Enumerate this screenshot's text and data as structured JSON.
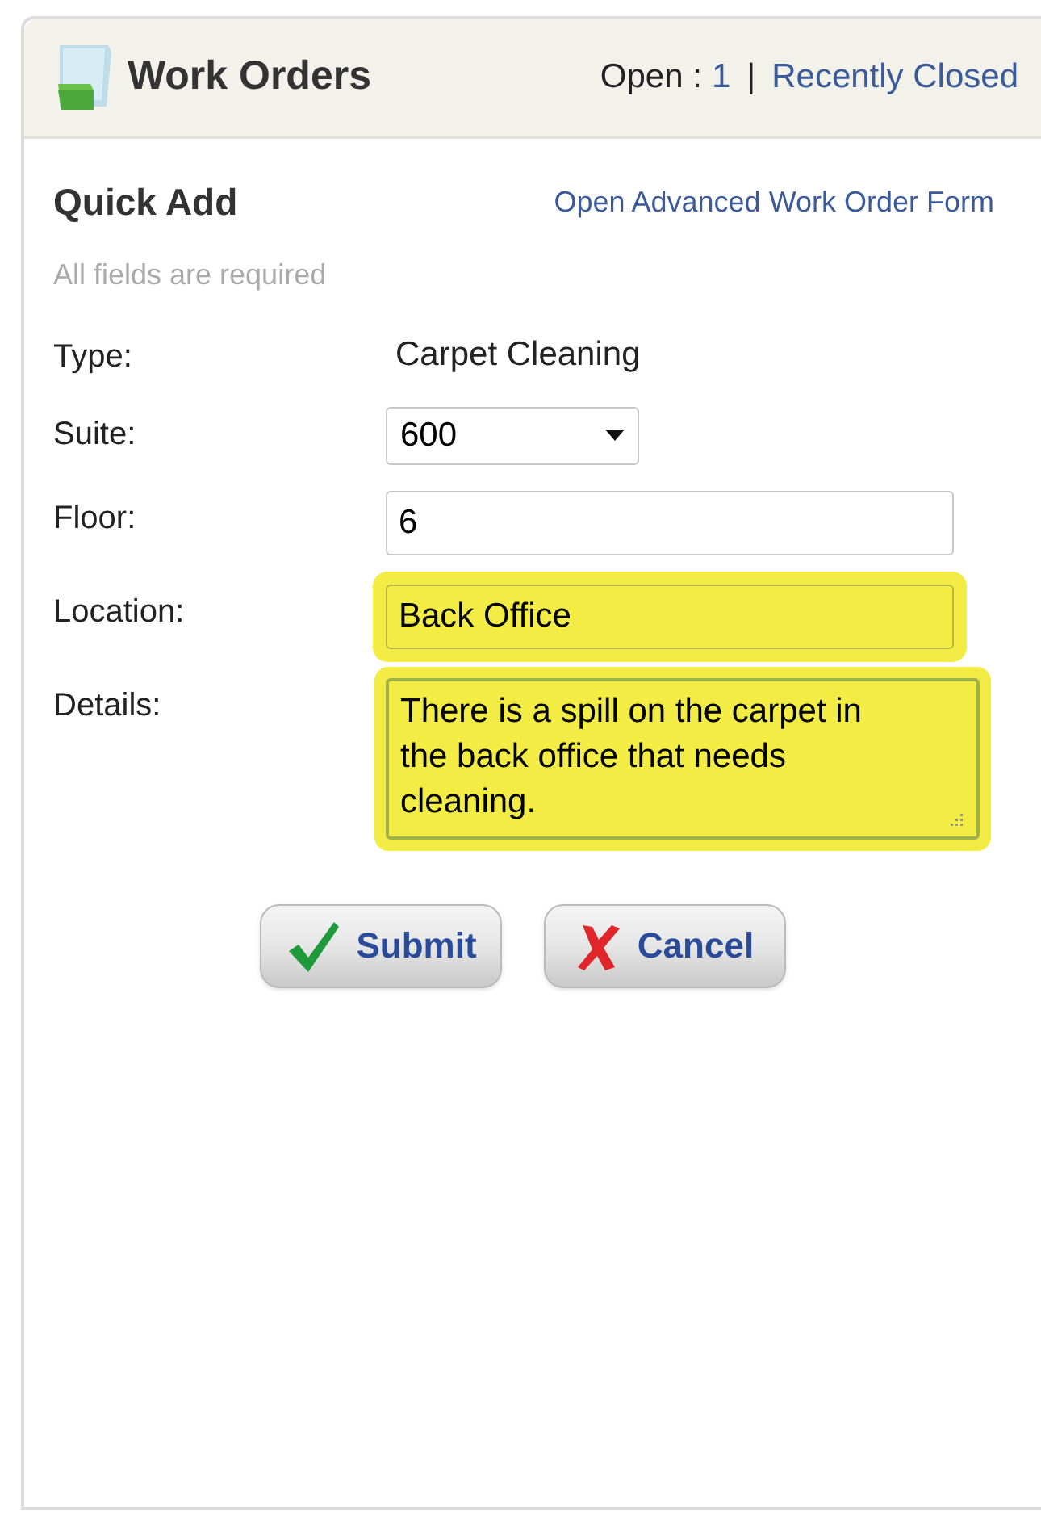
{
  "header": {
    "title": "Work Orders",
    "open_label": "Open :",
    "open_count": "1",
    "separator": "|",
    "recent_link": "Recently Closed"
  },
  "quick_add": {
    "title": "Quick Add",
    "advanced_link": "Open Advanced Work Order Form",
    "note": "All fields are required"
  },
  "fields": [
    {
      "kind": "static",
      "label": "Type:",
      "value": "Carpet Cleaning",
      "highlighted": false
    },
    {
      "kind": "select",
      "label": "Suite:",
      "value": "600",
      "highlighted": false
    },
    {
      "kind": "text",
      "label": "Floor:",
      "value": "6",
      "highlighted": false
    },
    {
      "kind": "text",
      "label": "Location:",
      "value": "Back Office",
      "highlighted": true
    },
    {
      "kind": "textarea",
      "label": "Details:",
      "value": "There is a spill on the carpet in the back office that needs cleaning.",
      "highlighted": true
    }
  ],
  "buttons": [
    {
      "kind": "submit",
      "label": "Submit"
    },
    {
      "kind": "cancel",
      "label": "Cancel"
    }
  ]
}
